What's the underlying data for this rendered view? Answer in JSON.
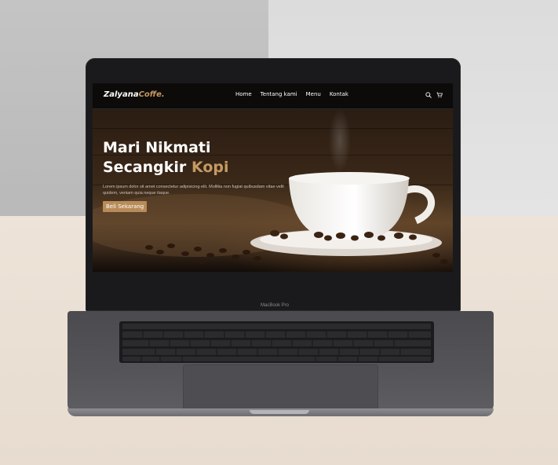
{
  "device": {
    "label": "MacBook Pro"
  },
  "site": {
    "logo": {
      "primary": "Zalyana",
      "accent": "Coffe."
    },
    "nav": {
      "items": [
        "Home",
        "Tentang kami",
        "Menu",
        "Kontak"
      ]
    },
    "icons": [
      "search-icon",
      "cart-icon"
    ],
    "hero": {
      "headline_line1": "Mari Nikmati",
      "headline_line2": "Secangkir",
      "headline_accent": "Kopi",
      "body": "Lorem ipsum dolor sit amet consectetur adipisicing elit. Mollitia non fugiat quibusdam vitae velit quidem, veniam quia neque itaque.",
      "cta_label": "Beli Sekarang"
    }
  },
  "colors": {
    "accent": "#c59a62",
    "button": "#b88b58",
    "nav_bg": "#0d0b09"
  }
}
